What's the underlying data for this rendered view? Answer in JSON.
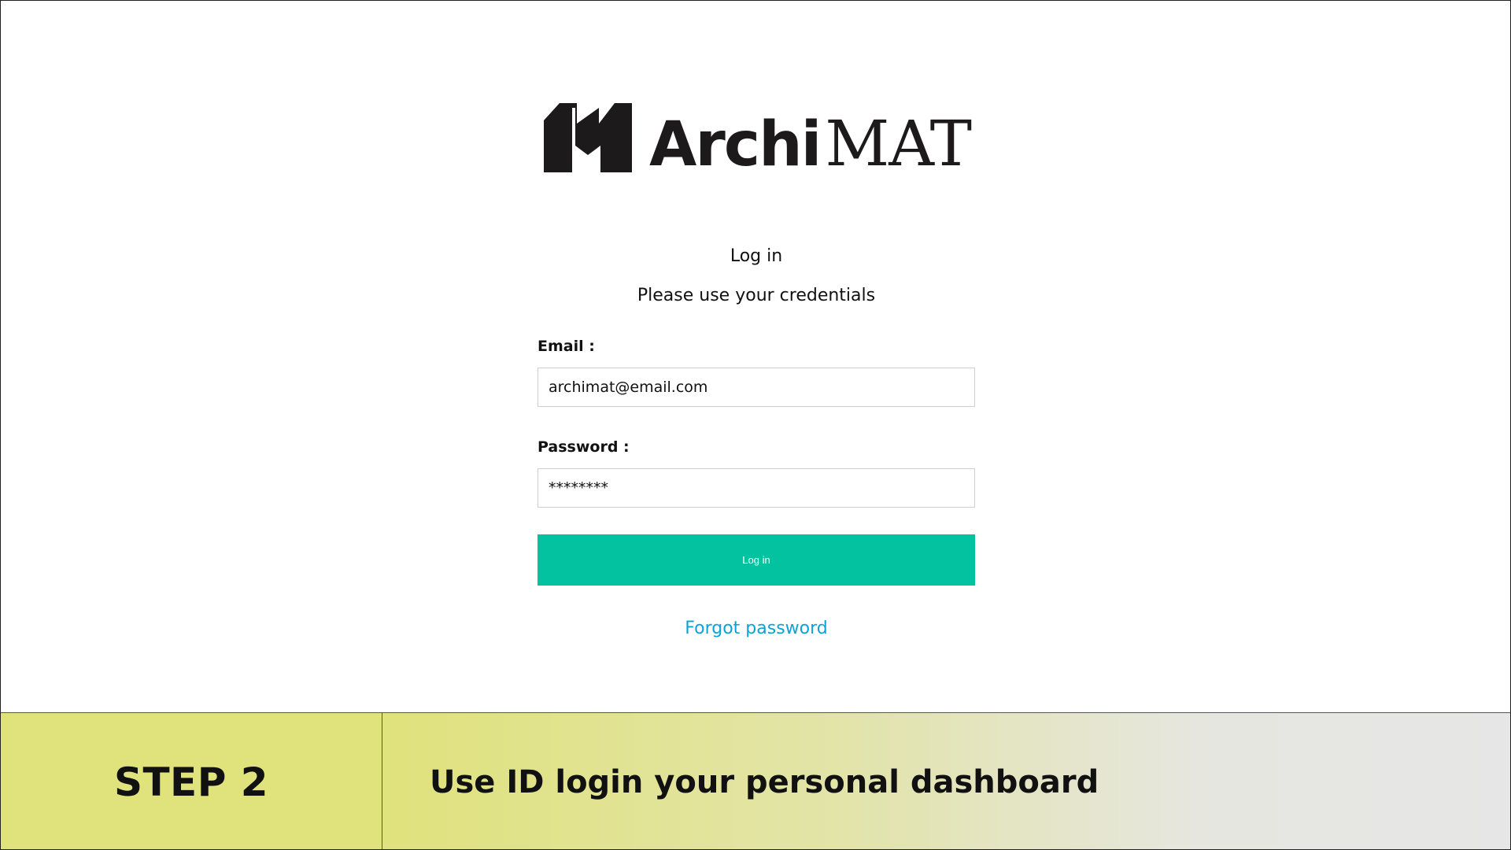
{
  "logo": {
    "part1": "Archi",
    "part2": "MAT",
    "icon": "building-mark-icon",
    "color": "#1c1a1a"
  },
  "login": {
    "title": "Log in",
    "subtitle": "Please use your credentials",
    "email_label": "Email :",
    "email_value": "archimat@email.com",
    "password_label": "Password :",
    "password_value": "********",
    "submit_label": "Log in",
    "forgot_label": "Forgot password",
    "accent_color": "#03c2a0",
    "link_color": "#0aa3d8"
  },
  "footer": {
    "step": "STEP 2",
    "description": "Use ID login your personal dashboard",
    "highlight_color": "#e0e27c"
  }
}
